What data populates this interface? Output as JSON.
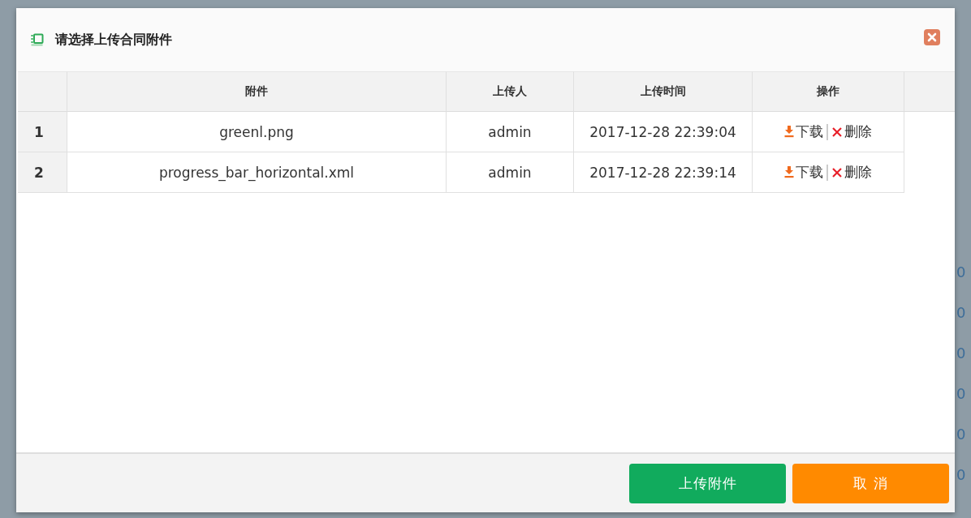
{
  "dialog": {
    "title": "请选择上传合同附件"
  },
  "table": {
    "columns": [
      "附件",
      "上传人",
      "上传时间",
      "操作"
    ],
    "rows": [
      {
        "index": "1",
        "file": "greenl.png",
        "uploader": "admin",
        "time": "2017-12-28 22:39:04",
        "actions": [
          "下载",
          "删除"
        ]
      },
      {
        "index": "2",
        "file": "progress_bar_horizontal.xml",
        "uploader": "admin",
        "time": "2017-12-28 22:39:14",
        "actions": [
          "下载",
          "删除"
        ]
      }
    ]
  },
  "buttons": [
    {
      "label": "上传附件",
      "kind": "primary"
    },
    {
      "label": "取 消",
      "kind": "cancel"
    }
  ],
  "background_cells": [
    "0",
    "0",
    "0",
    "0",
    "0",
    "0"
  ]
}
